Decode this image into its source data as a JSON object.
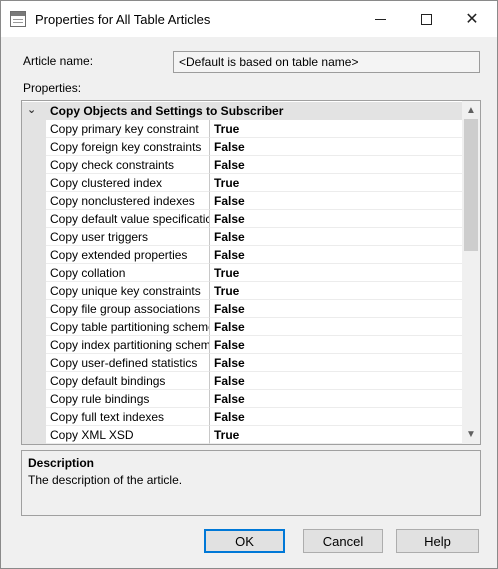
{
  "window": {
    "title": "Properties for All Table Articles",
    "app_icon": "table-icon",
    "controls": {
      "minimize": "minimize-icon",
      "maximize": "maximize-icon",
      "close": "✕"
    }
  },
  "form": {
    "article_name_label": "Article name:",
    "article_name_value": "<Default is based on table name>",
    "properties_label": "Properties:"
  },
  "grid": {
    "category": {
      "expand_glyph": "⌄",
      "label": "Copy Objects and Settings to Subscriber"
    },
    "properties": [
      {
        "name": "Copy primary key constraint",
        "value": "True"
      },
      {
        "name": "Copy foreign key constraints",
        "value": "False"
      },
      {
        "name": "Copy check constraints",
        "value": "False"
      },
      {
        "name": "Copy clustered index",
        "value": "True"
      },
      {
        "name": "Copy nonclustered indexes",
        "value": "False"
      },
      {
        "name": "Copy default value specificatic",
        "value": "False"
      },
      {
        "name": "Copy user triggers",
        "value": "False"
      },
      {
        "name": "Copy extended properties",
        "value": "False"
      },
      {
        "name": "Copy collation",
        "value": "True"
      },
      {
        "name": "Copy unique key constraints",
        "value": "True"
      },
      {
        "name": "Copy file group associations",
        "value": "False"
      },
      {
        "name": "Copy table partitioning scheme",
        "value": "False"
      },
      {
        "name": "Copy index partitioning scheme",
        "value": "False"
      },
      {
        "name": "Copy user-defined statistics",
        "value": "False"
      },
      {
        "name": "Copy default bindings",
        "value": "False"
      },
      {
        "name": "Copy rule bindings",
        "value": "False"
      },
      {
        "name": "Copy full text indexes",
        "value": "False"
      },
      {
        "name": "Copy XML XSD",
        "value": "True"
      }
    ],
    "scroll": {
      "up_glyph": "▲",
      "down_glyph": "▼"
    }
  },
  "description": {
    "title": "Description",
    "text": "The description of the article."
  },
  "buttons": {
    "ok": "OK",
    "cancel": "Cancel",
    "help": "Help"
  },
  "colors": {
    "accent_focus": "#0078d7",
    "window_bg": "#f0f0f0",
    "gutter": "#e3e3e3"
  }
}
